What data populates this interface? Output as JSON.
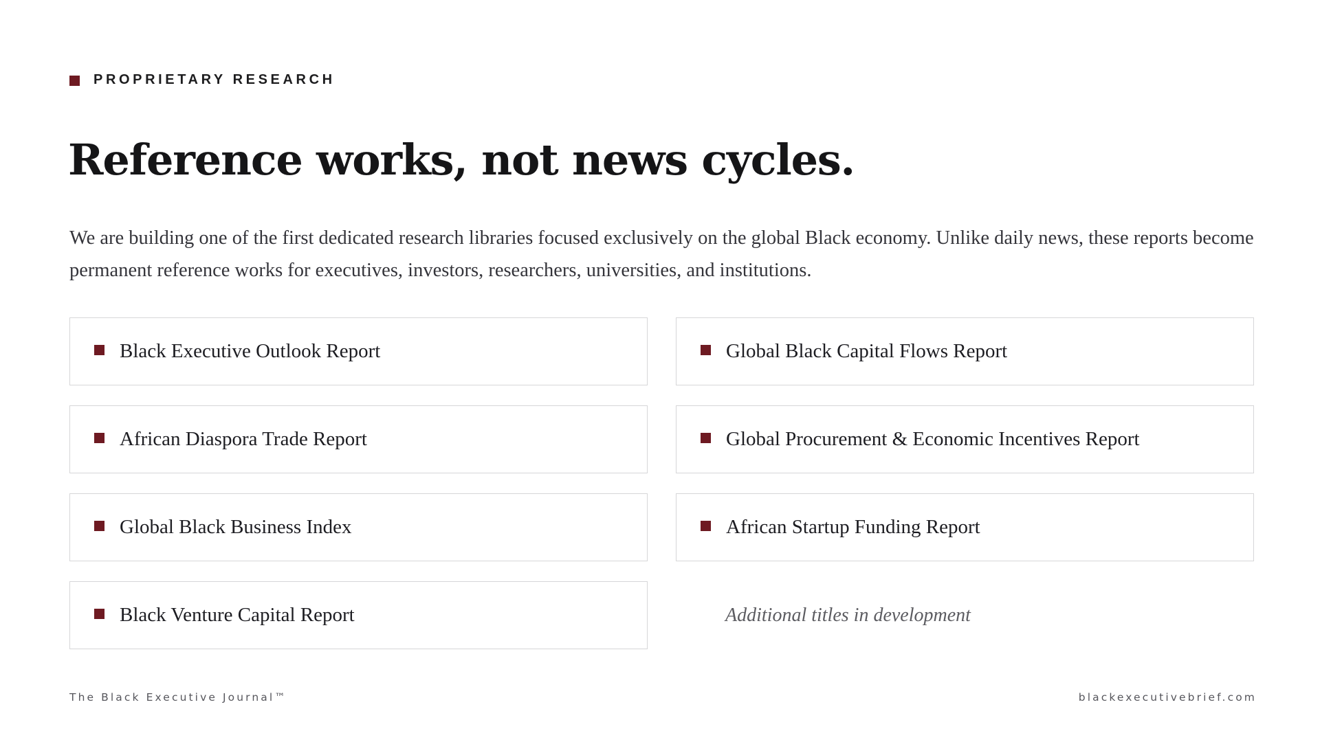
{
  "eyebrow": {
    "label": "PROPRIETARY RESEARCH"
  },
  "headline": "Reference works, not news cycles.",
  "intro": "We are building one of the first dedicated research libraries focused exclusively on the global Black economy. Unlike daily news, these reports become permanent reference works for executives, investors, researchers, universities, and institutions.",
  "reports": [
    "Black Executive Outlook Report",
    "Global Black Capital Flows Report",
    "African Diaspora Trade Report",
    "Global Procurement & Economic Incentives Report",
    "Global Black Business Index",
    "African Startup Funding Report",
    "Black Venture Capital Report"
  ],
  "development_note": "Additional titles in development",
  "footer": {
    "brand": "The Black Executive Journal™",
    "url": "blackexecutivebrief.com"
  },
  "colors": {
    "accent": "#6e1a22",
    "text": "#151517",
    "card_border": "#d6d6d8"
  },
  "icons": {
    "bullet": "square-bullet-icon"
  }
}
